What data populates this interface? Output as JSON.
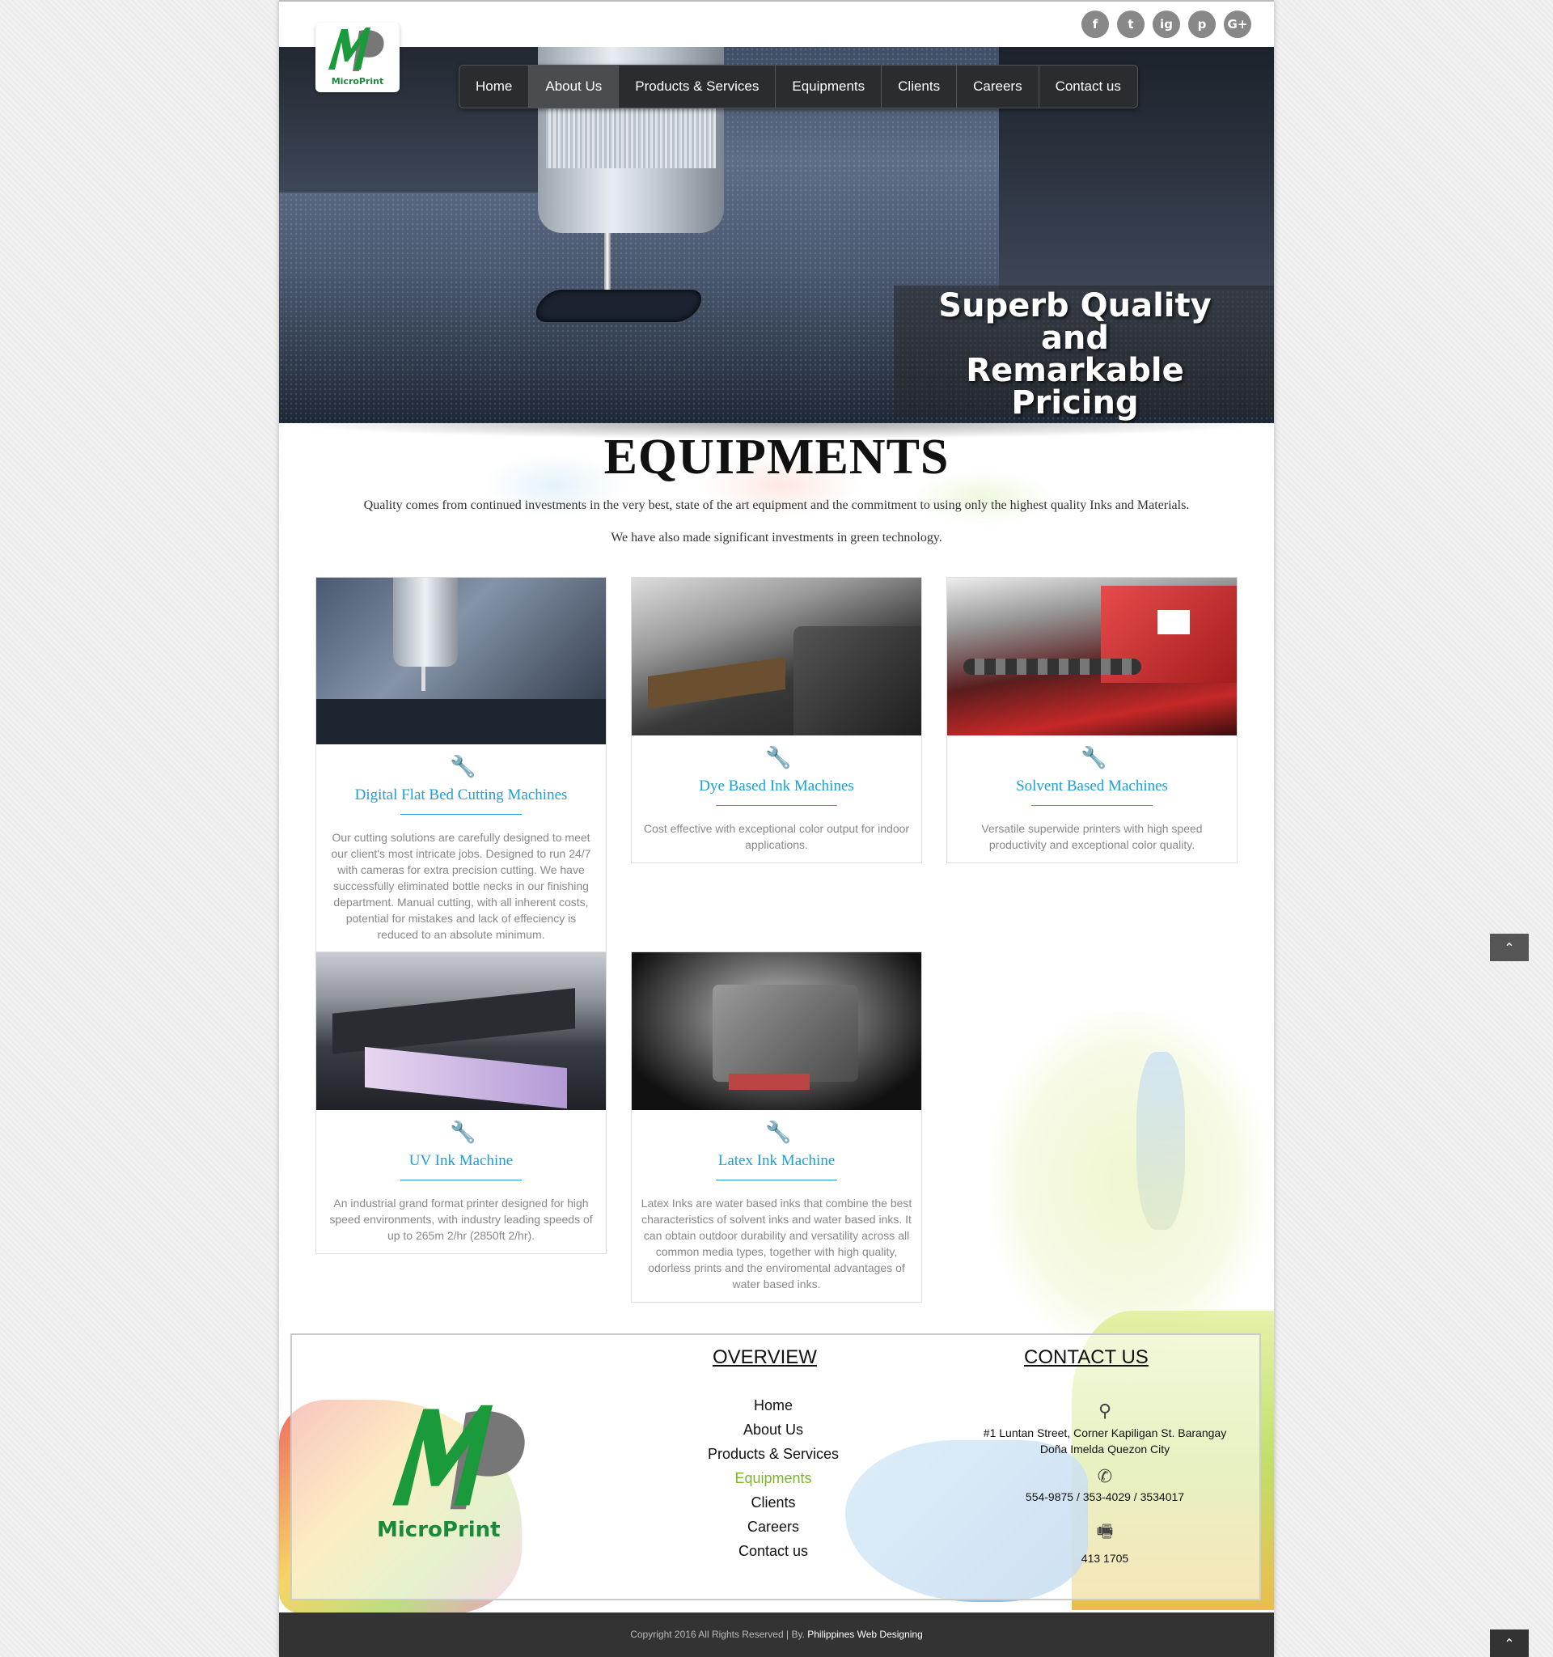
{
  "social": [
    "f",
    "t",
    "ig",
    "p",
    "G+"
  ],
  "logo": {
    "brand": "MicroPrint"
  },
  "nav": [
    "Home",
    "About Us",
    "Products & Services",
    "Equipments",
    "Clients",
    "Careers",
    "Contact us"
  ],
  "hero": {
    "line1": "Superb Quality",
    "line2": "and",
    "line3": "Remarkable Pricing"
  },
  "heading": "EQUIPMENTS",
  "intro": {
    "line1": "Quality comes from continued investments in the very best, state of the art equipment and the commitment to using only the highest quality Inks and Materials.",
    "line2": "We have also made significant investments in green technology."
  },
  "cards": [
    {
      "title": "Digital Flat Bed Cutting Machines",
      "desc": "Our cutting solutions are carefully designed to meet our client's most intricate jobs. Designed to run 24/7 with cameras for extra precision cutting. We have successfully eliminated bottle necks in our finishing department. Manual cutting, with all inherent costs, potential for mistakes and lack of effeciency is reduced to an absolute minimum."
    },
    {
      "title": "Dye Based Ink Machines",
      "desc": "Cost effective with exceptional color output for indoor applications."
    },
    {
      "title": "Solvent Based Machines",
      "desc": "Versatile superwide printers with high speed productivity and exceptional color quality."
    },
    {
      "title": "UV Ink Machine",
      "desc": "An industrial grand format printer designed for high speed environments, with industry leading speeds of up to 265m 2/hr (2850ft 2/hr)."
    },
    {
      "title": "Latex Ink Machine",
      "desc": "Latex Inks are water based inks that combine the best characteristics of solvent inks and water based inks. It can obtain outdoor durability and versatility across all common media types, together with high quality, odorless prints and the enviromental advantages of water based inks."
    }
  ],
  "footer": {
    "overview_title": "OVERVIEW",
    "contact_title": "CONTACT US",
    "links": [
      "Home",
      "About Us",
      "Products & Services",
      "Equipments",
      "Clients",
      "Careers",
      "Contact us"
    ],
    "active_link": "Equipments",
    "address": "#1 Luntan Street, Corner Kapiligan St. Barangay Doña Imelda Quezon City",
    "phone": "554-9875 / 353-4029 / 3534017",
    "fax": "413 1705",
    "brand": "MicroPrint"
  },
  "copyright": {
    "text": "Copyright 2016 All Rights Reserved | By.",
    "by": "Philippines Web Designing"
  },
  "colors": {
    "accent": "#1ba0d8",
    "wrench": "#e03030",
    "active": "#7ab52a",
    "nav_bg": "#2a2c30"
  }
}
